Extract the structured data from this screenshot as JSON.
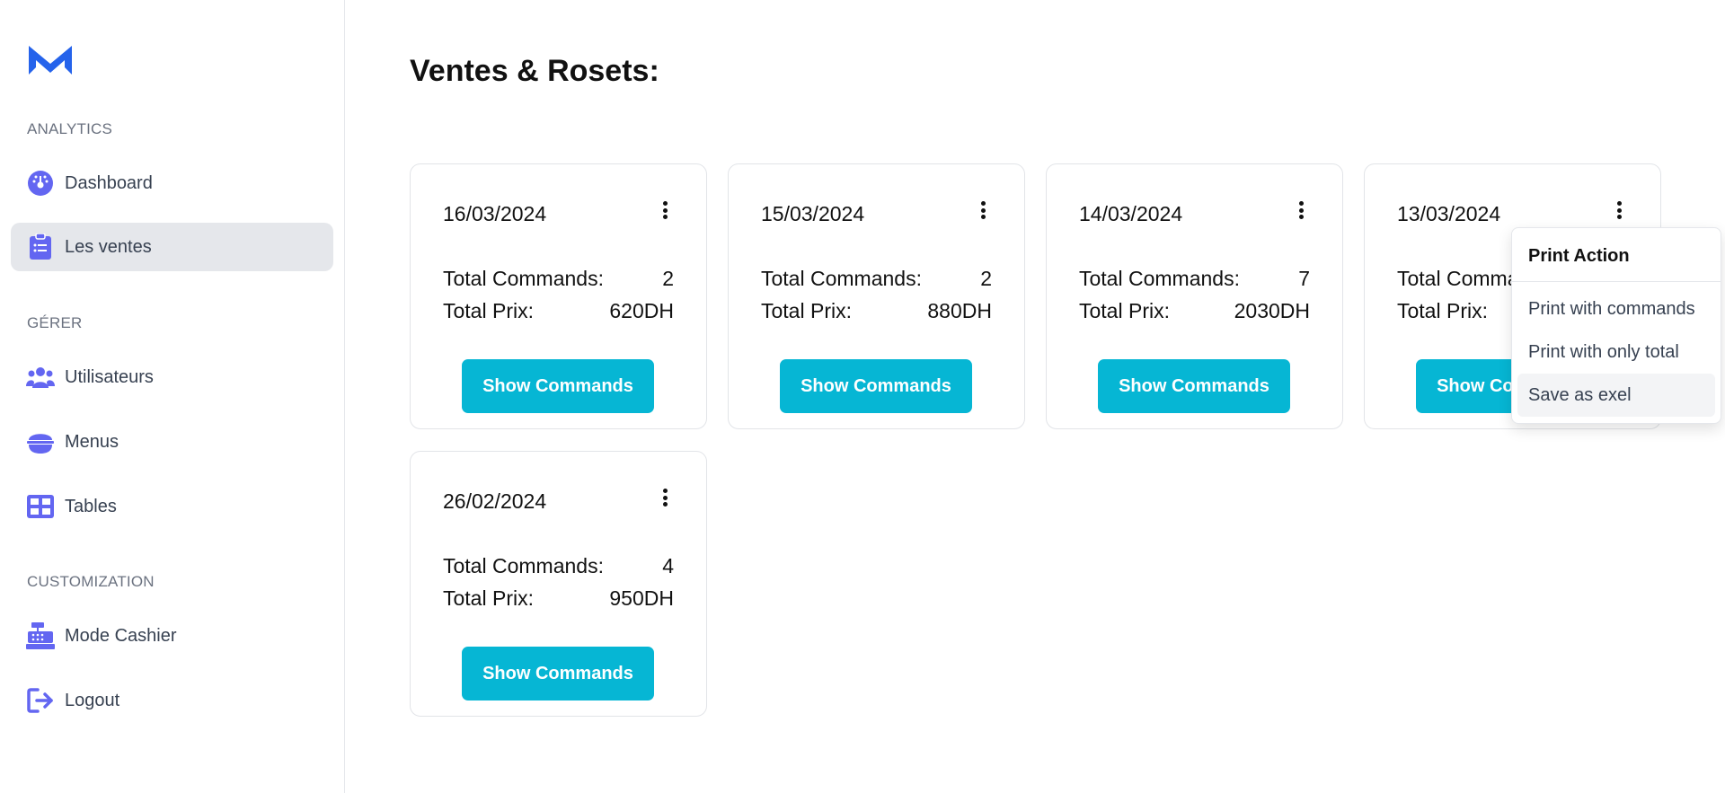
{
  "sidebar": {
    "sections": [
      {
        "label": "ANALYTICS"
      },
      {
        "label": "GÉRER"
      },
      {
        "label": "CUSTOMIZATION"
      }
    ],
    "items": [
      {
        "label": "Dashboard",
        "icon": "dashboard-gauge-icon"
      },
      {
        "label": "Les ventes",
        "icon": "clipboard-list-icon",
        "active": true
      },
      {
        "label": "Utilisateurs",
        "icon": "users-icon"
      },
      {
        "label": "Menus",
        "icon": "food-bowl-icon"
      },
      {
        "label": "Tables",
        "icon": "table-grid-icon"
      },
      {
        "label": "Mode Cashier",
        "icon": "cash-register-icon"
      },
      {
        "label": "Logout",
        "icon": "logout-icon"
      }
    ],
    "accent_color": "#6366f1"
  },
  "main": {
    "title": "Ventes & Rosets:",
    "button_color": "#06b6d4",
    "cards": [
      {
        "date": "16/03/2024",
        "commands_label": "Total Commands:",
        "commands": "2",
        "prix_label": "Total Prix:",
        "prix": "620DH",
        "button": "Show Commands"
      },
      {
        "date": "15/03/2024",
        "commands_label": "Total Commands:",
        "commands": "2",
        "prix_label": "Total Prix:",
        "prix": "880DH",
        "button": "Show Commands"
      },
      {
        "date": "14/03/2024",
        "commands_label": "Total Commands:",
        "commands": "7",
        "prix_label": "Total Prix:",
        "prix": "2030DH",
        "button": "Show Commands"
      },
      {
        "date": "13/03/2024",
        "commands_label": "Total Commands:",
        "commands": "",
        "prix_label": "Total Prix:",
        "prix": "",
        "button": "Show Commands"
      },
      {
        "date": "26/02/2024",
        "commands_label": "Total Commands:",
        "commands": "4",
        "prix_label": "Total Prix:",
        "prix": "950DH",
        "button": "Show Commands"
      }
    ]
  },
  "dropdown": {
    "header": "Print Action",
    "items": [
      "Print with commands",
      "Print with only total",
      "Save as exel"
    ]
  }
}
